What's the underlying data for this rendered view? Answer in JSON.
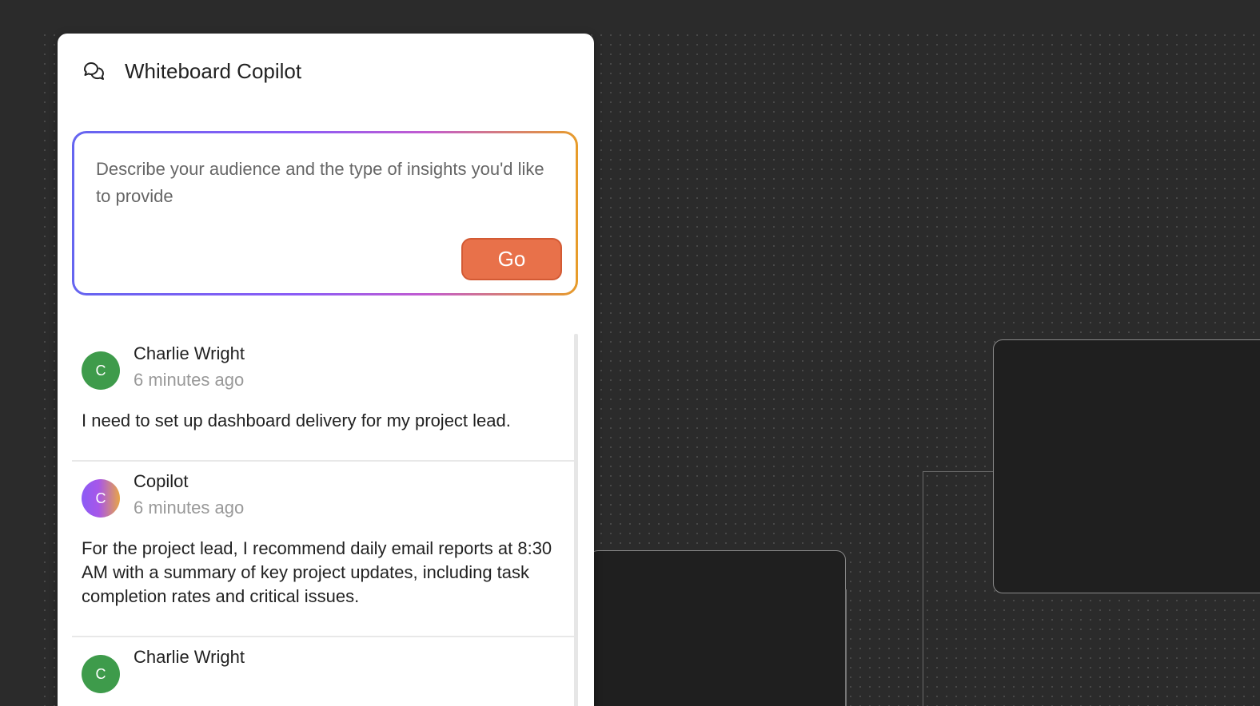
{
  "panel": {
    "title": "Whiteboard Copilot",
    "icon": "chat-bubbles-icon"
  },
  "prompt": {
    "placeholder": "Describe your audience and the type of insights you'd like to provide",
    "go_label": "Go",
    "gradient_colors": [
      "#6565f0",
      "#8b5cf6",
      "#c25bd0",
      "#e79c2a"
    ]
  },
  "messages": [
    {
      "author": "Charlie Wright",
      "initial": "C",
      "time": "6 minutes ago",
      "text": "I need to set up dashboard delivery for my project lead."
    },
    {
      "author": "Copilot",
      "initial": "C",
      "time": "6 minutes ago",
      "text": "For the project lead, I recommend daily email reports at 8:30 AM with a summary of key project updates, including task completion rates and critical issues."
    },
    {
      "author": "Charlie Wright",
      "initial": "C",
      "time": "",
      "text": ""
    }
  ],
  "colors": {
    "canvas_bg": "#2b2b2b",
    "node_bg": "#1f1f1f",
    "go_button": "#e8714a",
    "user_avatar": "#3e9b4b"
  }
}
